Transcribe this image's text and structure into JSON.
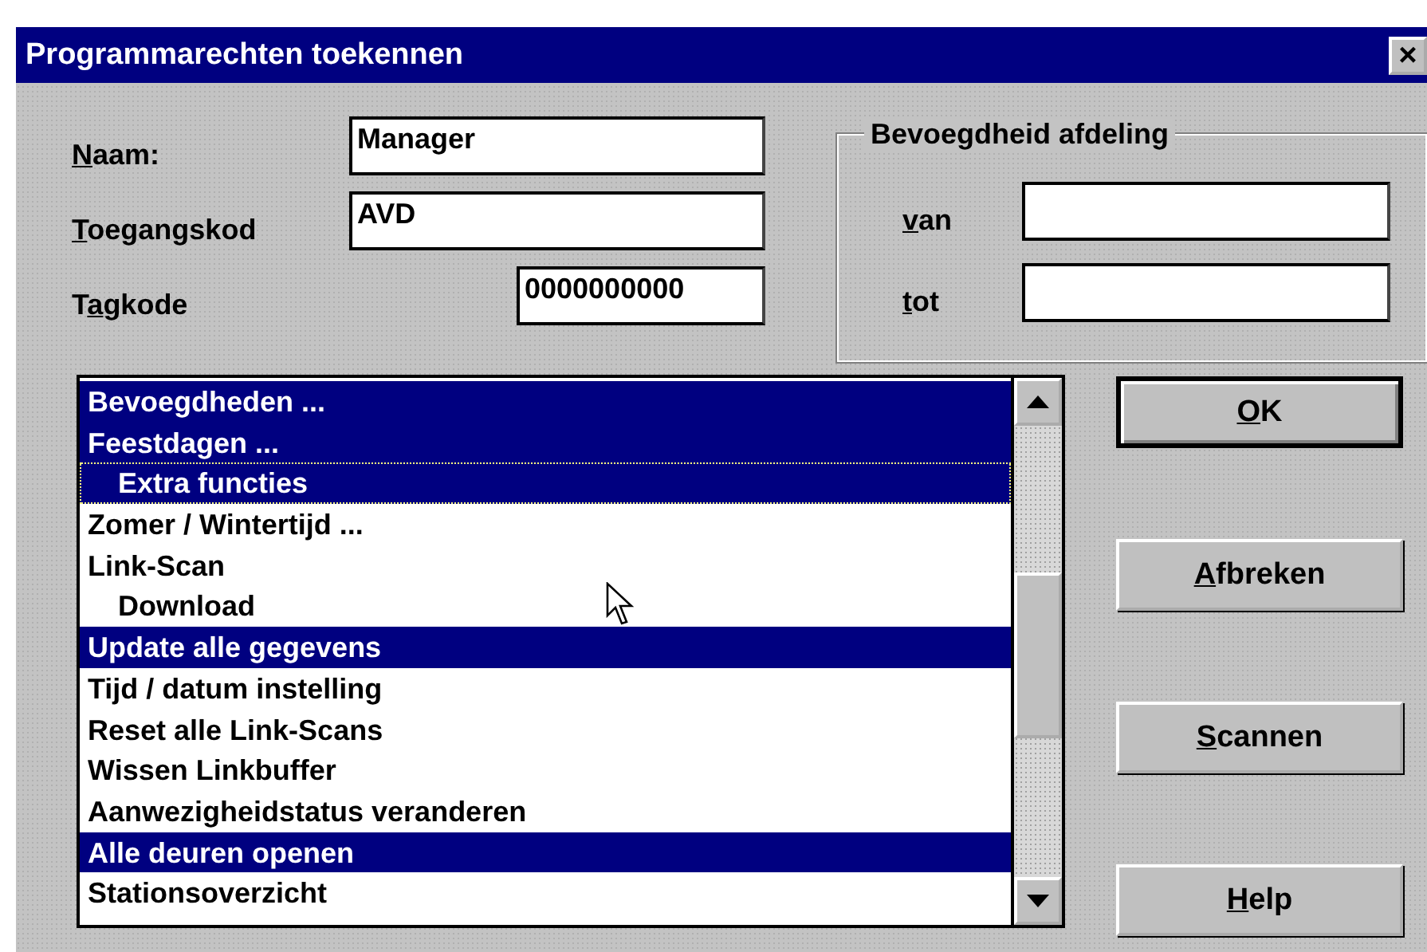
{
  "window": {
    "title": "Programmarechten toekennen",
    "close": "×"
  },
  "fields": [
    {
      "label": {
        "key": "N",
        "after": "aam:"
      },
      "value": "Manager",
      "kind": "wide"
    },
    {
      "label": {
        "key": "T",
        "after": "oegangskod"
      },
      "value": "AVD",
      "kind": "wide"
    },
    {
      "label": {
        "before": "T",
        "key": "a",
        "after": "gkode"
      },
      "value": "0000000000",
      "kind": "short"
    }
  ],
  "group": {
    "title": "Bevoegdheid afdeling",
    "fields": [
      {
        "label": {
          "key": "v",
          "after": "an"
        }
      },
      {
        "label": {
          "key": "t",
          "after": "ot"
        }
      }
    ]
  },
  "list": {
    "items": [
      {
        "label": "Bevoegdheden ...",
        "selected": true,
        "focused": false
      },
      {
        "label": "Feestdagen ...",
        "selected": true,
        "focused": false,
        "children": [
          {
            "label": "Extra functies",
            "selected": true,
            "focused": true
          }
        ]
      },
      {
        "label": "Zomer / Wintertijd ...",
        "selected": false,
        "focused": false
      },
      {
        "label": "Link-Scan",
        "selected": false,
        "focused": false,
        "children": [
          {
            "label": "Download",
            "selected": false,
            "focused": false
          }
        ]
      },
      {
        "label": "Update alle gegevens",
        "selected": true,
        "focused": false
      },
      {
        "label": "Tijd / datum instelling",
        "selected": false,
        "focused": false
      },
      {
        "label": "Reset alle Link-Scans",
        "selected": false,
        "focused": false
      },
      {
        "label": "Wissen Linkbuffer",
        "selected": false,
        "focused": false
      },
      {
        "label": "Aanwezigheidstatus veranderen",
        "selected": false,
        "focused": false
      },
      {
        "label": "Alle deuren openen",
        "selected": true,
        "focused": false
      },
      {
        "label": "Stationsoverzicht",
        "selected": false,
        "focused": false
      }
    ]
  },
  "buttons": [
    {
      "label": {
        "key": "O",
        "after": "K"
      },
      "default": true
    },
    {
      "label": {
        "key": "A",
        "after": "fbreken"
      },
      "default": false
    },
    {
      "label": {
        "key": "S",
        "after": "cannen"
      },
      "default": false
    },
    {
      "label": {
        "key": "H",
        "after": "elp"
      },
      "default": false
    }
  ]
}
